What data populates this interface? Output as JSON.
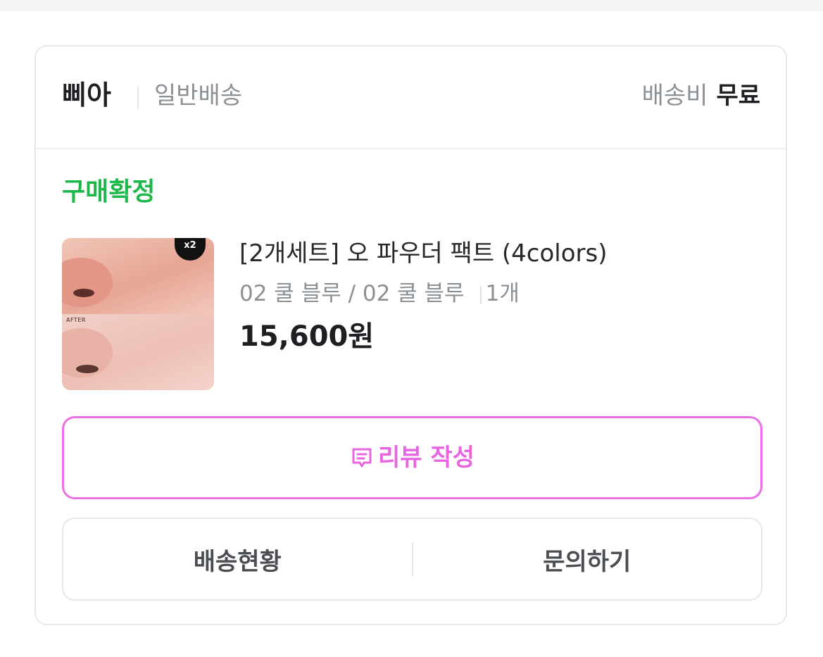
{
  "order": {
    "seller": "삐아",
    "delivery_type": "일반배송",
    "shipping_fee_label": "배송비",
    "shipping_fee_value": "무료",
    "status": "구매확정"
  },
  "product": {
    "title": "[2개세트] 오 파우더 팩트 (4colors)",
    "option": "02 쿨 블루 / 02 쿨 블루",
    "quantity": "1개",
    "price": "15,600원",
    "thumbnail": {
      "badge": "x2",
      "after_label": "AFTER"
    }
  },
  "actions": {
    "review": "리뷰 작성",
    "delivery_status": "배송현황",
    "inquiry": "문의하기"
  },
  "colors": {
    "status_green": "#1eb84a",
    "review_pink": "#e765e0",
    "review_border": "#ec6fe6"
  },
  "icons": {
    "review": "review-speech-bubble-icon"
  }
}
